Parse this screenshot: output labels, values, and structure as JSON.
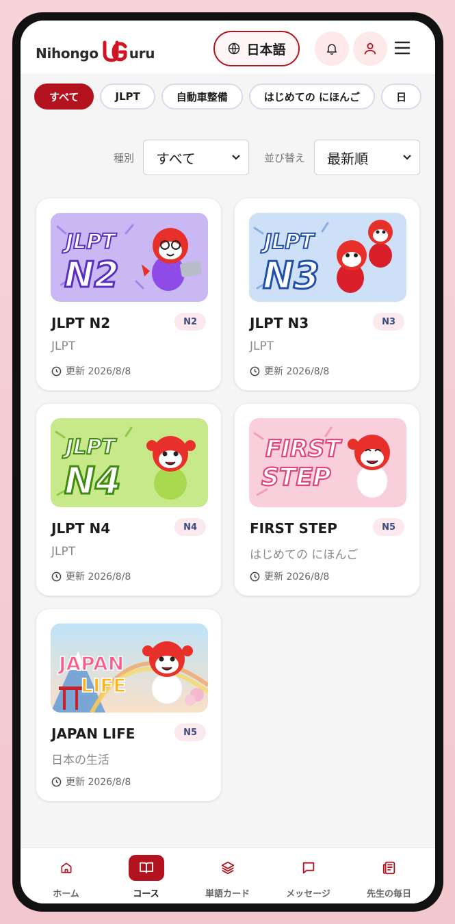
{
  "brand": {
    "word1": "Nihongo",
    "mark": "UG",
    "word2": "uru",
    "accent": "#b3121f"
  },
  "header": {
    "language_label": "日本語"
  },
  "chips": [
    "すべて",
    "JLPT",
    "自動車整備",
    "はじめての にほんご",
    "日"
  ],
  "filters": {
    "type_label": "種別",
    "type_value": "すべて",
    "sort_label": "並び替え",
    "sort_value": "最新順"
  },
  "courses": [
    {
      "title": "JLPT N2",
      "level": "N2",
      "category": "JLPT",
      "updated": "更新 2026/8/8",
      "thumb_text": [
        "JLPT",
        "N2"
      ]
    },
    {
      "title": "JLPT N3",
      "level": "N3",
      "category": "JLPT",
      "updated": "更新 2026/8/8",
      "thumb_text": [
        "JLPT",
        "N3"
      ]
    },
    {
      "title": "JLPT N4",
      "level": "N4",
      "category": "JLPT",
      "updated": "更新 2026/8/8",
      "thumb_text": [
        "JLPT",
        "N4"
      ]
    },
    {
      "title": "FIRST STEP",
      "level": "N5",
      "category": "はじめての にほんご",
      "updated": "更新 2026/8/8",
      "thumb_text": [
        "FIRST",
        "STEP"
      ]
    },
    {
      "title": "JAPAN LIFE",
      "level": "N5",
      "category": "日本の生活",
      "updated": "更新 2026/8/8",
      "thumb_text": [
        "JAPAN",
        "LIFE"
      ]
    }
  ],
  "bottom_nav": [
    {
      "label": "ホーム",
      "icon": "home-icon"
    },
    {
      "label": "コース",
      "icon": "book-icon",
      "active": true
    },
    {
      "label": "単語カード",
      "icon": "layers-icon"
    },
    {
      "label": "メッセージ",
      "icon": "message-icon"
    },
    {
      "label": "先生の毎日",
      "icon": "newspaper-icon"
    }
  ]
}
